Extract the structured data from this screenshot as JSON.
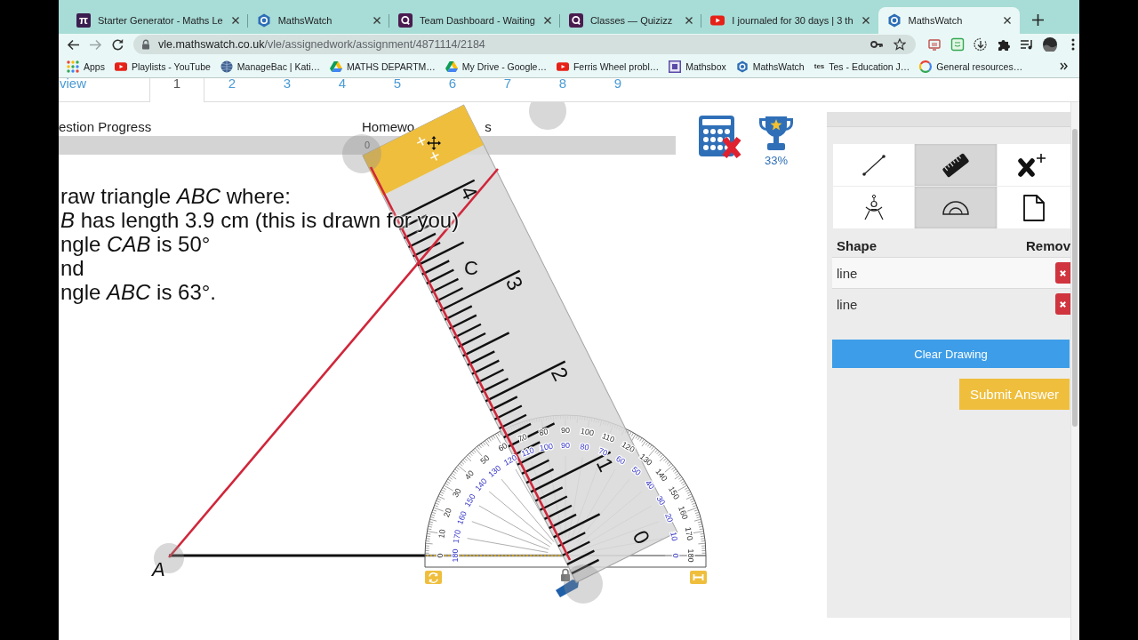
{
  "browser": {
    "tabs": [
      {
        "title": "Starter Generator - Maths Le",
        "kind": "pi",
        "logo_text": "π",
        "selected": false
      },
      {
        "title": "MathsWatch",
        "kind": "mathswatch",
        "selected": false
      },
      {
        "title": "Team Dashboard - Waiting",
        "kind": "quizizz",
        "selected": false
      },
      {
        "title": "Classes — Quizizz",
        "kind": "quizizz",
        "selected": false
      },
      {
        "title": "I journaled for 30 days | 3 th",
        "kind": "youtube",
        "selected": false
      },
      {
        "title": "MathsWatch",
        "kind": "mathswatch",
        "selected": true
      }
    ],
    "url_host": "vle.mathswatch.co.uk",
    "url_path": "/vle/assignedwork/assignment/4871114/2184",
    "bookmarks": [
      {
        "label": "Apps",
        "kind": "apps"
      },
      {
        "label": "Playlists - YouTube",
        "kind": "youtube"
      },
      {
        "label": "ManageBac | Kati…",
        "kind": "globe"
      },
      {
        "label": "MATHS DEPARTM…",
        "kind": "drive"
      },
      {
        "label": "My Drive - Google…",
        "kind": "drive"
      },
      {
        "label": "Ferris Wheel probl…",
        "kind": "youtube"
      },
      {
        "label": "Mathsbox",
        "kind": "mathsbox"
      },
      {
        "label": "MathsWatch",
        "kind": "mathswatch"
      },
      {
        "label": "Tes - Education J…",
        "kind": "tes",
        "logo_text": "tes"
      },
      {
        "label": "General resources…",
        "kind": "google"
      }
    ]
  },
  "question_nav": [
    {
      "label": "view",
      "selected": false
    },
    {
      "label": "1",
      "selected": true
    },
    {
      "label": "2",
      "selected": false
    },
    {
      "label": "3",
      "selected": false
    },
    {
      "label": "4",
      "selected": false
    },
    {
      "label": "5",
      "selected": false
    },
    {
      "label": "6",
      "selected": false
    },
    {
      "label": "7",
      "selected": false
    },
    {
      "label": "8",
      "selected": false
    },
    {
      "label": "9",
      "selected": false
    }
  ],
  "progress": {
    "question": {
      "label": "estion Progress"
    },
    "homework": {
      "label": "Homewo",
      "tail": "s",
      "value": "0"
    }
  },
  "status": {
    "calculator_allowed": false,
    "score": "33%"
  },
  "question": {
    "lines": [
      "raw triangle *ABC* where:",
      "*B* has length 3.9 cm (this is drawn for you)",
      "ngle *CAB* is 50°",
      "nd",
      "ngle *ABC* is 63°."
    ]
  },
  "canvas": {
    "points": [
      {
        "label": "A"
      },
      {
        "label": "C"
      }
    ],
    "ruler": {
      "numbers": [
        "4",
        "3",
        "2",
        "1",
        "0"
      ]
    },
    "protractor": {
      "outer_scale": [
        "0",
        "10",
        "20",
        "30",
        "40",
        "50",
        "60",
        "70",
        "80",
        "90",
        "100",
        "110",
        "120",
        "130",
        "140",
        "150",
        "160",
        "170",
        "180"
      ],
      "inner_scale": [
        "180",
        "170",
        "160",
        "150",
        "140",
        "130",
        "120",
        "110",
        "100",
        "90",
        "80",
        "70",
        "60",
        "50",
        "40",
        "30",
        "20",
        "10",
        "0"
      ]
    }
  },
  "tools": [
    {
      "kind": "line",
      "selected": false
    },
    {
      "kind": "ruler",
      "selected": true
    },
    {
      "kind": "point",
      "selected": false
    },
    {
      "kind": "compass",
      "selected": false
    },
    {
      "kind": "protractor",
      "selected": true
    },
    {
      "kind": "page",
      "selected": false
    }
  ],
  "shapes": {
    "columns": [
      "Shape",
      "Remov"
    ],
    "rows": [
      "line",
      "line"
    ]
  },
  "buttons": [
    {
      "label": "Clear Drawing",
      "kind": "clear"
    },
    {
      "label": "Submit Answer",
      "kind": "submit"
    }
  ]
}
